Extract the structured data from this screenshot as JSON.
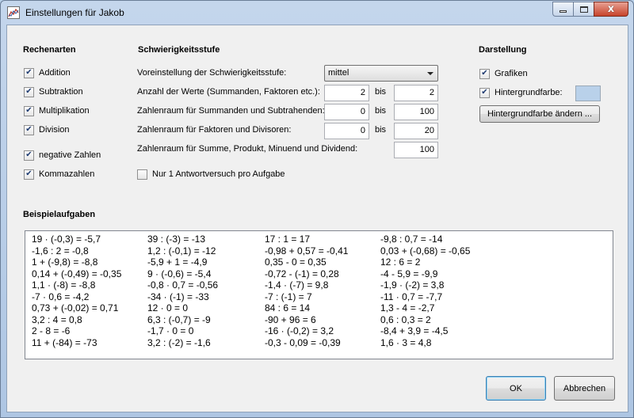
{
  "window": {
    "title": "Einstellungen für Jakob",
    "buttons": {
      "min": "minimize",
      "max": "maximize",
      "close": "x"
    }
  },
  "rechenarten": {
    "heading": "Rechenarten",
    "items": [
      {
        "label": "Addition",
        "checked": true
      },
      {
        "label": "Subtraktion",
        "checked": true
      },
      {
        "label": "Multiplikation",
        "checked": true
      },
      {
        "label": "Division",
        "checked": true
      },
      {
        "label": "negative Zahlen",
        "checked": true
      },
      {
        "label": "Kommazahlen",
        "checked": true
      }
    ]
  },
  "schwierigkeit": {
    "heading": "Schwierigkeitsstufe",
    "voreinstellung_label": "Voreinstellung der Schwierigkeitsstufe:",
    "voreinstellung_value": "mittel",
    "anzahl_label": "Anzahl der Werte (Summanden, Faktoren etc.):",
    "anzahl_from": "2",
    "anzahl_to": "2",
    "summanden_label": "Zahlenraum für Summanden und Subtrahenden:",
    "summanden_from": "0",
    "summanden_to": "100",
    "faktoren_label": "Zahlenraum für Faktoren und Divisoren:",
    "faktoren_from": "0",
    "faktoren_to": "20",
    "summe_label": "Zahlenraum für Summe, Produkt, Minuend und Dividend:",
    "summe_value": "100",
    "bis": "bis",
    "einversuch_label": "Nur 1 Antwortversuch pro Aufgabe",
    "einversuch_checked": false
  },
  "darstellung": {
    "heading": "Darstellung",
    "grafiken_label": "Grafiken",
    "hintergrund_label": "Hintergrundfarbe:",
    "hintergrund_color": "#b9d1ea",
    "aendern_label": "Hintergrundfarbe ändern ..."
  },
  "beispiele": {
    "heading": "Beispielaufgaben",
    "columns": [
      [
        "19 · (-0,3) = -5,7",
        "-1,6 : 2 = -0,8",
        "1 + (-9,8) = -8,8",
        "0,14 + (-0,49) = -0,35",
        "1,1 · (-8) = -8,8",
        "-7 · 0,6 = -4,2",
        "0,73 + (-0,02) = 0,71",
        "3,2 : 4 = 0,8",
        "2 - 8 = -6",
        "11 + (-84) = -73"
      ],
      [
        "39 : (-3) = -13",
        "1,2 : (-0,1) = -12",
        "-5,9 + 1 = -4,9",
        "9 · (-0,6) = -5,4",
        "-0,8 · 0,7 = -0,56",
        "-34 · (-1) = -33",
        "12 · 0 = 0",
        "6,3 : (-0,7) = -9",
        "-1,7 · 0 = 0",
        "3,2 : (-2) = -1,6"
      ],
      [
        "17 : 1 = 17",
        "-0,98 + 0,57 = -0,41",
        "0,35 - 0 = 0,35",
        "-0,72 - (-1) = 0,28",
        "-1,4 · (-7) = 9,8",
        "-7 : (-1) = 7",
        "84 : 6 = 14",
        "-90 + 96 = 6",
        "-16 · (-0,2) = 3,2",
        "-0,3 - 0,09 = -0,39"
      ],
      [
        "-9,8 : 0,7 = -14",
        "0,03 + (-0,68) = -0,65",
        "12 : 6 = 2",
        "-4 - 5,9 = -9,9",
        "-1,9 · (-2) = 3,8",
        "-11 · 0,7 = -7,7",
        "1,3 - 4 = -2,7",
        "0,6 : 0,3 = 2",
        "-8,4 + 3,9 = -4,5",
        "1,6 · 3 = 4,8"
      ]
    ]
  },
  "footer": {
    "ok_label": "OK",
    "abbrechen_label": "Abbrechen"
  }
}
